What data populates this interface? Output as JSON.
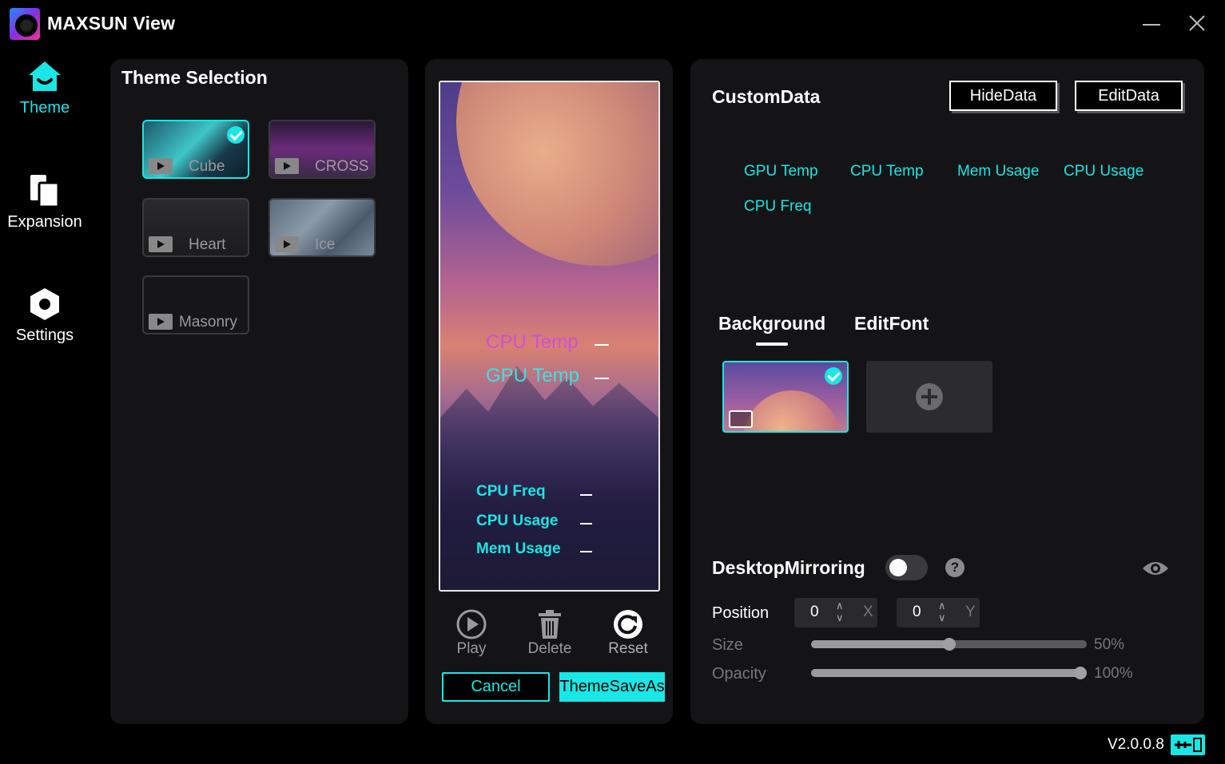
{
  "app": {
    "title": "MAXSUN View",
    "version": "V2.0.0.8"
  },
  "colors": {
    "accent": "#19e6e6",
    "panel": "#141416",
    "background": "#000000"
  },
  "nav": {
    "items": [
      {
        "label": "Theme",
        "icon": "home-icon",
        "active": true
      },
      {
        "label": "Expansion",
        "icon": "expansion-icon",
        "active": false
      },
      {
        "label": "Settings",
        "icon": "gear-icon",
        "active": false
      }
    ]
  },
  "theme_panel": {
    "title": "Theme Selection",
    "themes": [
      {
        "name": "Cube",
        "selected": true
      },
      {
        "name": "CROSS",
        "selected": false
      },
      {
        "name": "Heart",
        "selected": false
      },
      {
        "name": "Ice",
        "selected": false
      },
      {
        "name": "Masonry",
        "selected": false
      }
    ]
  },
  "preview": {
    "overlay_items": [
      "CPU Temp",
      "GPU Temp",
      "CPU Freq",
      "CPU Usage",
      "Mem Usage"
    ],
    "controls": {
      "play": "Play",
      "delete": "Delete",
      "reset": "Reset"
    },
    "cancel_label": "Cancel",
    "save_as_label": "ThemeSaveAs"
  },
  "custom_panel": {
    "title": "CustomData",
    "hide_label": "HideData",
    "edit_label": "EditData",
    "data_items": [
      "GPU Temp",
      "CPU Temp",
      "Mem Usage",
      "CPU Usage",
      "CPU Freq"
    ],
    "tabs": [
      "Background",
      "EditFont"
    ],
    "active_tab": "Background",
    "mirroring": {
      "label": "DesktopMirroring",
      "enabled": false,
      "help": "?",
      "position_label": "Position",
      "x_value": "0",
      "x_axis": "X",
      "y_value": "0",
      "y_axis": "Y",
      "size_label": "Size",
      "size_value": "50%",
      "size_fraction": 0.5,
      "opacity_label": "Opacity",
      "opacity_value": "100%",
      "opacity_fraction": 1.0
    }
  }
}
